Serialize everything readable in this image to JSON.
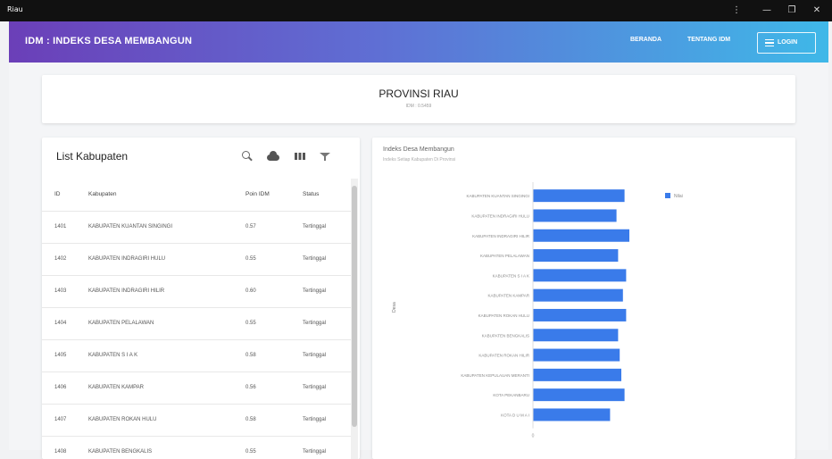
{
  "window": {
    "title": "Riau",
    "controls": [
      "⋮",
      "—",
      "❐",
      "✕"
    ]
  },
  "appbar": {
    "brand": "IDM : INDEKS DESA MEMBANGUN",
    "nav": [
      {
        "label": "BERANDA"
      },
      {
        "label": "TENTANG IDM"
      }
    ],
    "login_label": "LOGIN"
  },
  "province": {
    "title": "PROVINSI RIAU",
    "subtitle": "IDM : 0.5459"
  },
  "list": {
    "title": "List Kabupaten",
    "columns": {
      "id": "ID",
      "kabupaten": "Kabupaten",
      "poin": "Poin IDM",
      "status": "Status"
    },
    "rows": [
      {
        "id": "1401",
        "kabupaten": "KABUPATEN KUANTAN SINGINGI",
        "poin": "0.57",
        "status": "Tertinggal"
      },
      {
        "id": "1402",
        "kabupaten": "KABUPATEN INDRAGIRI HULU",
        "poin": "0.55",
        "status": "Tertinggal"
      },
      {
        "id": "1403",
        "kabupaten": "KABUPATEN INDRAGIRI HILIR",
        "poin": "0.60",
        "status": "Tertinggal"
      },
      {
        "id": "1404",
        "kabupaten": "KABUPATEN PELALAWAN",
        "poin": "0.55",
        "status": "Tertinggal"
      },
      {
        "id": "1405",
        "kabupaten": "KABUPATEN S I A K",
        "poin": "0.58",
        "status": "Tertinggal"
      },
      {
        "id": "1406",
        "kabupaten": "KABUPATEN KAMPAR",
        "poin": "0.56",
        "status": "Tertinggal"
      },
      {
        "id": "1407",
        "kabupaten": "KABUPATEN ROKAN HULU",
        "poin": "0.58",
        "status": "Tertinggal"
      },
      {
        "id": "1408",
        "kabupaten": "KABUPATEN BENGKALIS",
        "poin": "0.55",
        "status": "Tertinggal"
      }
    ]
  },
  "chart": {
    "title": "Indeks Desa Membangun",
    "subtitle": "Indeks Setiap Kabupaten Di Provinsi",
    "ylabel": "Desa"
  },
  "chart_data": {
    "type": "bar",
    "orientation": "horizontal",
    "categories": [
      "KABUPATEN KUANTAN SINGINGI",
      "KABUPATEN INDRAGIRI HULU",
      "KABUPATEN INDRAGIRI HILIR",
      "KABUPATEN PELALAWAN",
      "KABUPATEN S I A K",
      "KABUPATEN KAMPAR",
      "KABUPATEN ROKAN HULU",
      "KABUPATEN BENGKALIS",
      "KABUPATEN ROKAN HILIR",
      "KABUPATEN KEPULAUAN MERANTI",
      "KOTA PEKANBARU",
      "KOTA D U M A I"
    ],
    "series": [
      {
        "name": "Nilai",
        "color": "#3a7bea",
        "values": [
          0.57,
          0.52,
          0.6,
          0.53,
          0.58,
          0.56,
          0.58,
          0.53,
          0.54,
          0.55,
          0.57,
          0.48
        ]
      }
    ],
    "xticks": [
      "0"
    ],
    "legend": "top-right"
  }
}
